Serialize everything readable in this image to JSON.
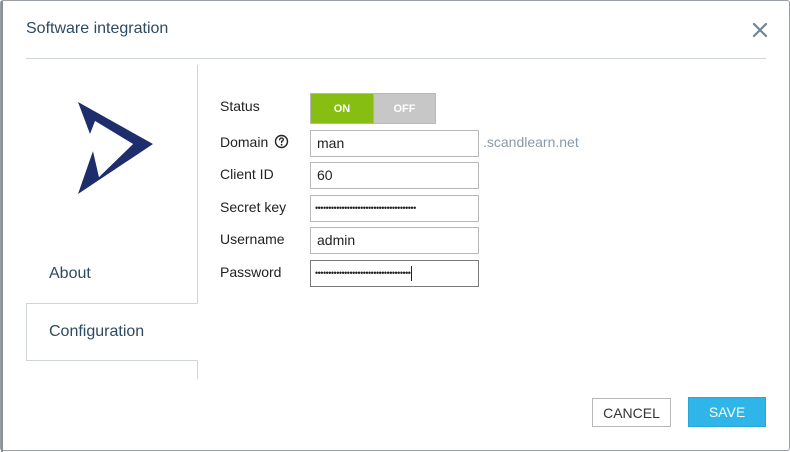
{
  "dialog": {
    "title": "Software integration"
  },
  "sidebar": {
    "items": [
      {
        "label": "About"
      },
      {
        "label": "Configuration",
        "active": true
      }
    ]
  },
  "form": {
    "status": {
      "label": "Status",
      "on_label": "ON",
      "off_label": "OFF",
      "value": "ON"
    },
    "domain": {
      "label": "Domain",
      "value": "man",
      "suffix": ".scandlearn.net"
    },
    "client_id": {
      "label": "Client ID",
      "value": "60"
    },
    "secret_key": {
      "label": "Secret key",
      "value": "••••••••••••••••••••••••••••••••••••••"
    },
    "username": {
      "label": "Username",
      "value": "admin"
    },
    "password": {
      "label": "Password",
      "value": "••••••••••••••••••••••••••••••••••••"
    }
  },
  "footer": {
    "cancel_label": "CANCEL",
    "save_label": "SAVE"
  },
  "colors": {
    "accent_on": "#86be12",
    "save_button": "#2fb5e8",
    "logo": "#1e2d6b",
    "title_text": "#2d4a63"
  },
  "icons": {
    "close": "close-icon",
    "help": "help-circle-icon",
    "logo": "app-logo"
  }
}
